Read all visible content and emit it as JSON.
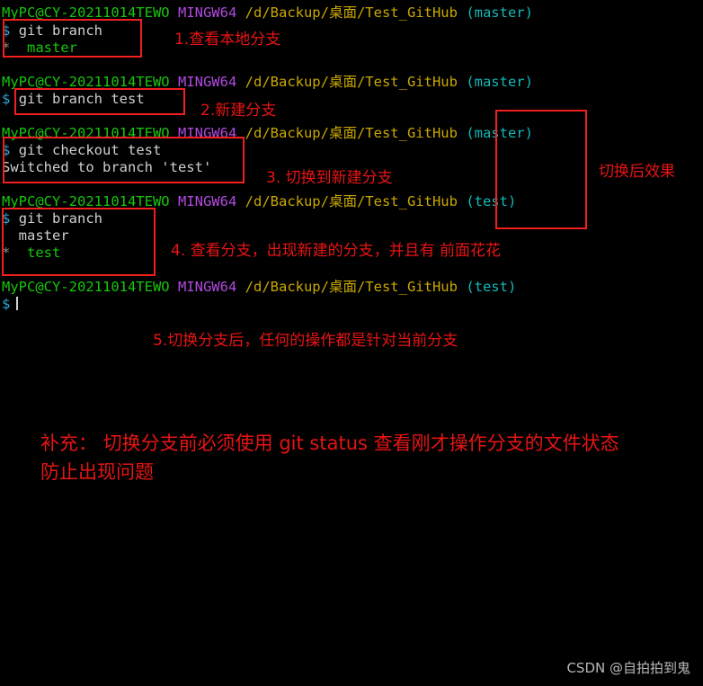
{
  "terminal": {
    "prompt_user": "MyPC@CY-20211014TEWO",
    "prompt_shell": "MINGW64",
    "prompt_path": "/d/Backup/桌面/Test_GitHub",
    "branch_master": "(master)",
    "branch_test": "(test)",
    "dollar": "$",
    "lines": {
      "cmd_git_branch_1": "git branch",
      "out_master_1": "  master",
      "star_1": "*",
      "cmd_git_branch_test": "git branch test",
      "cmd_git_checkout_test": "git checkout test",
      "out_switched": "Switched to branch 'test'",
      "cmd_git_branch_2": "git branch",
      "out_master_2": "  master",
      "out_test_2": "  test",
      "star_2": "*"
    }
  },
  "annotations": {
    "note1": "1.查看本地分支",
    "note2": "2.新建分支",
    "note3": "3. 切换到新建分支",
    "note4": "4. 查看分支，出现新建的分支，并且有 前面花花",
    "note5": "5.切换分支后，任何的操作都是针对当前分支",
    "note_side": "切换后效果",
    "note_extra_line1": "补充： 切换分支前必须使用 git status 查看刚才操作分支的文件状态",
    "note_extra_line2": "防止出现问题"
  },
  "watermark": "CSDN @自拍拍到鬼",
  "colors": {
    "background": "#000000",
    "annotation_red": "#e81414",
    "box_red": "#f21f1f",
    "user_green": "#16c60c",
    "shell_purple": "#b14ae0",
    "path_yellow": "#c9a800",
    "branch_cyan": "#14b8b8",
    "prompt_blue": "#2aa8d8",
    "text_gray": "#cfcfcf",
    "watermark_gray": "#b9b9b9"
  }
}
